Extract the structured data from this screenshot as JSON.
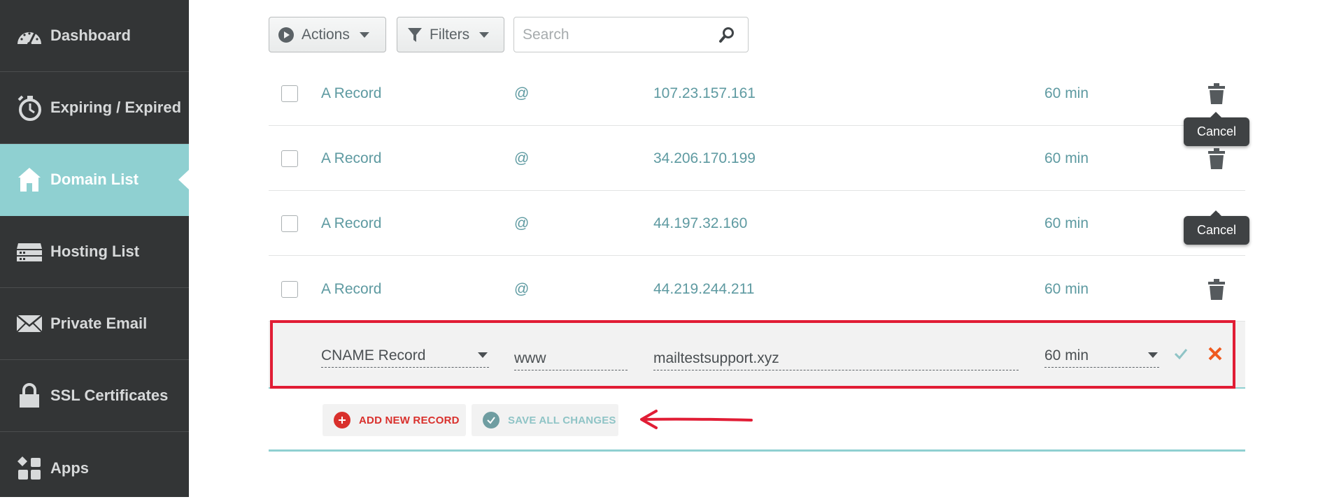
{
  "sidebar": {
    "items": [
      {
        "label": "Dashboard",
        "icon": "speedometer-icon"
      },
      {
        "label": "Expiring / Expired",
        "icon": "stopwatch-icon"
      },
      {
        "label": "Domain List",
        "icon": "home-icon",
        "active": true
      },
      {
        "label": "Hosting List",
        "icon": "server-icon"
      },
      {
        "label": "Private Email",
        "icon": "envelope-icon"
      },
      {
        "label": "SSL Certificates",
        "icon": "lock-icon"
      },
      {
        "label": "Apps",
        "icon": "apps-grid-icon"
      }
    ]
  },
  "toolbar": {
    "actions_label": "Actions",
    "filters_label": "Filters",
    "search_placeholder": "Search"
  },
  "records": [
    {
      "type": "A Record",
      "host": "@",
      "value": "107.23.157.161",
      "ttl": "60 min"
    },
    {
      "type": "A Record",
      "host": "@",
      "value": "34.206.170.199",
      "ttl": "60 min"
    },
    {
      "type": "A Record",
      "host": "@",
      "value": "44.197.32.160",
      "ttl": "60 min"
    },
    {
      "type": "A Record",
      "host": "@",
      "value": "44.219.244.211",
      "ttl": "60 min"
    }
  ],
  "edit_record": {
    "type": "CNAME Record",
    "host": "www",
    "value": "mailtestsupport.xyz",
    "ttl": "60 min"
  },
  "tooltips": {
    "cancel_1": "Cancel",
    "cancel_2": "Cancel"
  },
  "footer": {
    "add_label": "ADD NEW RECORD",
    "save_label": "SAVE ALL CHANGES"
  },
  "colors": {
    "sidebar_bg": "#333536",
    "active_teal": "#8fd0d1",
    "record_text": "#5e9aa1",
    "highlight_red": "#e11d35",
    "add_red": "#d9302c",
    "cancel_orange": "#ef5a1f"
  }
}
